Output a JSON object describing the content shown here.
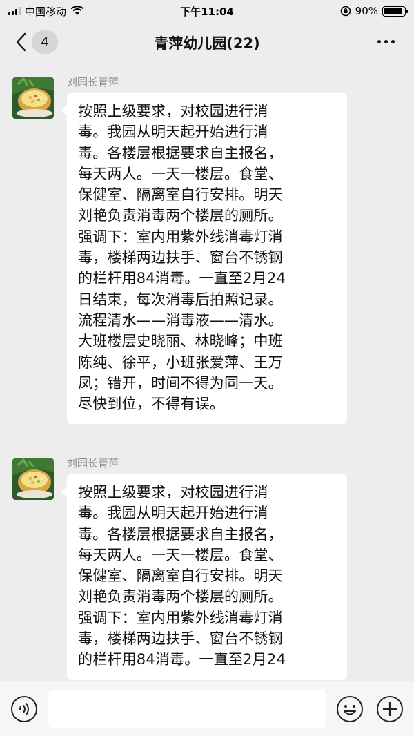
{
  "status_bar": {
    "carrier": "中国移动",
    "time": "下午11:04",
    "battery": "90%",
    "battery_level": 0.9,
    "icons": [
      "signal-icon",
      "wifi-icon",
      "rotation-lock-icon",
      "battery-icon"
    ]
  },
  "nav": {
    "back_badge": "4",
    "title": "青萍幼儿园(22)",
    "icons": [
      "back-chevron-icon",
      "more-icon"
    ]
  },
  "messages": [
    {
      "sender": "刘园长青萍",
      "avatar": "avatar-food-icon",
      "text": "按照上级要求，对校园进行消毒。我园从明天起开始进行消毒。各楼层根据要求自主报名，每天两人。一天一楼层。食堂、保健室、隔离室自行安排。明天刘艳负责消毒两个楼层的厕所。强调下：室内用紫外线消毒灯消毒，楼梯两边扶手、窗台不锈钢的栏杆用84消毒。一直至2月24日结束，每次消毒后拍照记录。流程清水——消毒液——清水。大班楼层史晓丽、林晓峰；中班陈纯、徐平，小班张爱萍、王万凤；错开，时间不得为同一天。尽快到位，不得有误。",
      "lines": [
        "按照上级要求，对校园进行消",
        "毒。我园从明天起开始进行消",
        "毒。各楼层根据要求自主报名，",
        "每天两人。一天一楼层。食堂、",
        "保健室、隔离室自行安排。明天",
        "刘艳负责消毒两个楼层的厕所。",
        "强调下：室内用紫外线消毒灯消",
        "毒，楼梯两边扶手、窗台不锈钢",
        "的栏杆用84消毒。一直至2月24",
        "日结束，每次消毒后拍照记录。",
        "流程清水——消毒液——清水。",
        "大班楼层史晓丽、林晓峰；中班",
        "陈纯、徐平，小班张爱萍、王万",
        "凤；错开，时间不得为同一天。",
        "尽快到位，不得有误。"
      ]
    },
    {
      "sender": "刘园长青萍",
      "avatar": "avatar-food-icon",
      "text": "按照上级要求，对校园进行消毒。我园从明天起开始进行消毒。各楼层根据要求自主报名，每天两人。一天一楼层。食堂、保健室、隔离室自行安排。明天刘艳负责消毒两个楼层的厕所。强调下：室内用紫外线消毒灯消毒，楼梯两边扶手、窗台不锈钢的栏杆用84消毒。一直至2月24",
      "lines": [
        "按照上级要求，对校园进行消",
        "毒。我园从明天起开始进行消",
        "毒。各楼层根据要求自主报名，",
        "每天两人。一天一楼层。食堂、",
        "保健室、隔离室自行安排。明天",
        "刘艳负责消毒两个楼层的厕所。",
        "强调下：室内用紫外线消毒灯消",
        "毒，楼梯两边扶手、窗台不锈钢",
        "的栏杆用84消毒。一直至2月24"
      ]
    }
  ],
  "input_bar": {
    "placeholder": "",
    "icons": [
      "voice-icon",
      "emoji-icon",
      "plus-icon"
    ]
  },
  "colors": {
    "background": "#ededed",
    "bubble": "#ffffff",
    "sender_text": "#8a8a8a",
    "input_bar": "#f6f6f6"
  }
}
